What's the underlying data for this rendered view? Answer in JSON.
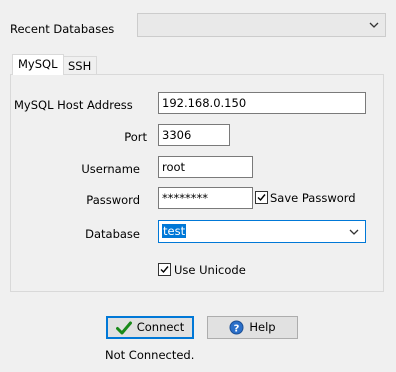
{
  "recent_databases": {
    "label": "Recent Databases",
    "value": ""
  },
  "tabs": [
    {
      "label": "MySQL",
      "active": true
    },
    {
      "label": "SSH",
      "active": false
    }
  ],
  "fields": {
    "host": {
      "label": "MySQL Host Address",
      "value": "192.168.0.150"
    },
    "port": {
      "label": "Port",
      "value": "3306"
    },
    "username": {
      "label": "Username",
      "value": "root"
    },
    "password": {
      "label": "Password",
      "value": "********"
    },
    "save_password": {
      "label": "Save Password",
      "checked": true
    },
    "database": {
      "label": "Database",
      "value": "test"
    },
    "use_unicode": {
      "label": "Use Unicode",
      "checked": true
    }
  },
  "buttons": {
    "connect": {
      "label": "Connect",
      "icon": "check-icon"
    },
    "help": {
      "label": "Help",
      "icon": "help-icon"
    }
  },
  "status": "Not Connected.",
  "colors": {
    "accent": "#0078d7",
    "check_green": "#1a8a1a",
    "background": "#f0f0f0"
  }
}
